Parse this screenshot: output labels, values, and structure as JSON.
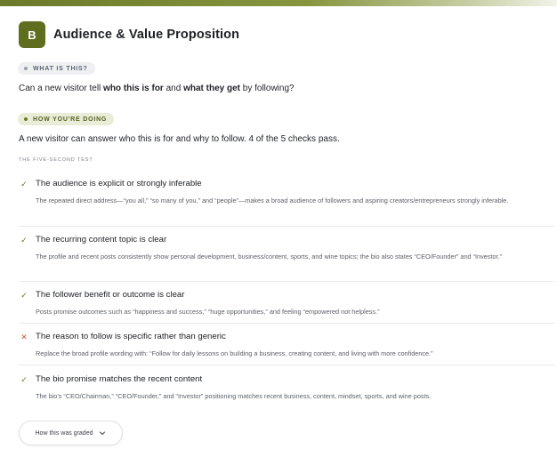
{
  "section": {
    "badge": "B",
    "title": "Audience & Value Proposition"
  },
  "what_pill": {
    "label": "WHAT IS THIS?"
  },
  "question": {
    "part1": "Can a new visitor tell ",
    "bold1": "who this is for",
    "part2": " and ",
    "bold2": "what they get",
    "part3": " by following?"
  },
  "how_pill": {
    "label": "HOW YOU'RE DOING"
  },
  "summary": "A new visitor can answer who this is for and why to follow. 4 of the 5 checks pass.",
  "test_label": "THE FIVE-SECOND TEST",
  "checks": [
    {
      "status": "pass",
      "icon": "check-icon",
      "title": "The audience is explicit or strongly inferable",
      "detail": "The repeated direct address—“you all,” “so many of you,” and “people”—makes a broad audience of followers and aspiring creators/entrepreneurs strongly inferable."
    },
    {
      "status": "pass",
      "icon": "check-icon",
      "title": "The recurring content topic is clear",
      "detail": "The profile and recent posts consistently show personal development, business/content, sports, and wine topics; the bio also states “CEO/Founder” and “Investor.”"
    },
    {
      "status": "pass",
      "icon": "check-icon",
      "title": "The follower benefit or outcome is clear",
      "detail": "Posts promise outcomes such as “happiness and success,” “huge opportunities,” and feeling “empowered not helpless.”"
    },
    {
      "status": "fail",
      "icon": "x-icon",
      "title": "The reason to follow is specific rather than generic",
      "detail": "Replace the broad profile wording with: “Follow for daily lessons on building a business, creating content, and living with more confidence.”"
    },
    {
      "status": "pass",
      "icon": "check-icon",
      "title": "The bio promise matches the recent content",
      "detail": "The bio's “CEO/Chairman,” “CEO/Founder,” and “Investor” positioning matches recent business, content, mindset, sports, and wine posts."
    }
  ],
  "graded_button": {
    "label": "How this was graded",
    "icon": "chevron-down-icon"
  },
  "colors": {
    "accent": "#5f6d1f",
    "pass": "#5f7a16",
    "fail": "#d2532f"
  }
}
